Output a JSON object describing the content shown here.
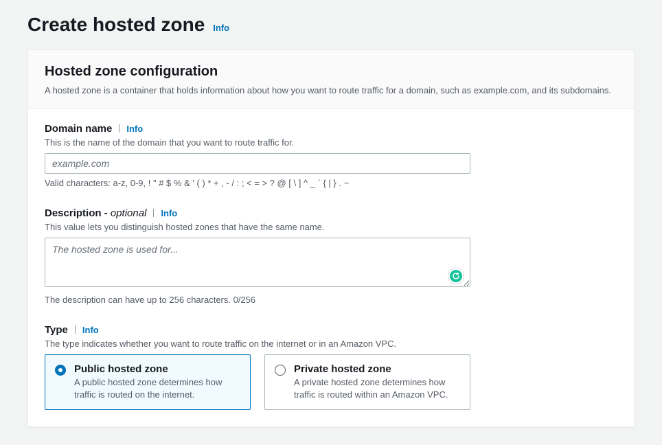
{
  "page": {
    "title": "Create hosted zone",
    "infoLabel": "Info"
  },
  "panel": {
    "title": "Hosted zone configuration",
    "description": "A hosted zone is a container that holds information about how you want to route traffic for a domain, such as example.com, and its subdomains."
  },
  "domain": {
    "label": "Domain name",
    "infoLabel": "Info",
    "hint": "This is the name of the domain that you want to route traffic for.",
    "placeholder": "example.com",
    "value": "",
    "validChars": "Valid characters: a-z, 0-9, ! \" # $ % & ' ( ) * + , - / : ; < = > ? @ [ \\ ] ^ _ ` { | } . ~"
  },
  "description": {
    "label": "Description - ",
    "optional": "optional",
    "infoLabel": "Info",
    "hint": "This value lets you distinguish hosted zones that have the same name.",
    "placeholder": "The hosted zone is used for...",
    "value": "",
    "footnote": "The description can have up to 256 characters. 0/256"
  },
  "type": {
    "label": "Type",
    "infoLabel": "Info",
    "hint": "The type indicates whether you want to route traffic on the internet or in an Amazon VPC.",
    "options": [
      {
        "title": "Public hosted zone",
        "desc": "A public hosted zone determines how traffic is routed on the internet.",
        "selected": true
      },
      {
        "title": "Private hosted zone",
        "desc": "A private hosted zone determines how traffic is routed within an Amazon VPC.",
        "selected": false
      }
    ]
  }
}
